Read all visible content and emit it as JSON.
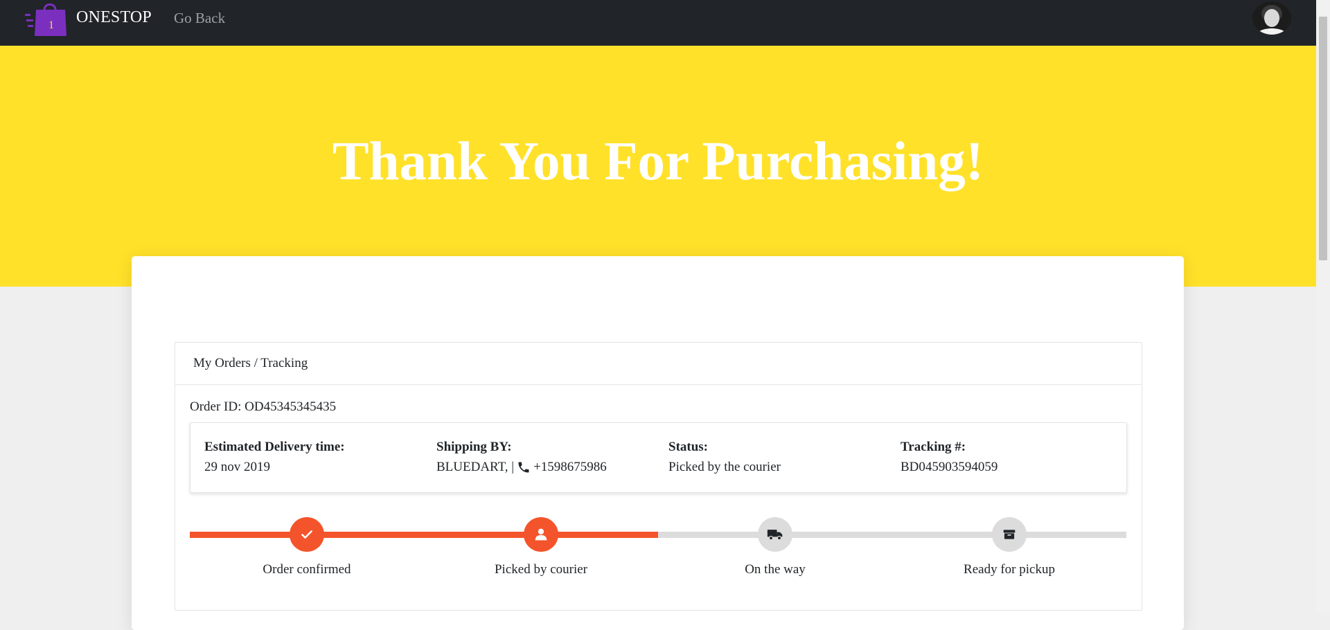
{
  "nav": {
    "logo_badge": "1",
    "brand": "ONESTOP",
    "go_back": "Go Back"
  },
  "hero": {
    "title": "Thank You For Purchasing!"
  },
  "tracking": {
    "breadcrumb": "My Orders / Tracking",
    "order_id": "Order ID: OD45345345435",
    "info": {
      "delivery_label": "Estimated Delivery time:",
      "delivery_value": "29 nov 2019",
      "shipping_label": "Shipping BY:",
      "shipping_value": "BLUEDART, |",
      "shipping_phone": "+1598675986",
      "status_label": "Status:",
      "status_value": "Picked by the courier",
      "tracking_label": "Tracking #:",
      "tracking_value": "BD045903594059"
    },
    "progress_fraction": 0.5,
    "steps": [
      {
        "label": "Order confirmed",
        "icon": "check-icon",
        "active": true
      },
      {
        "label": "Picked by courier",
        "icon": "user-icon",
        "active": true
      },
      {
        "label": "On the way",
        "icon": "truck-icon",
        "active": false
      },
      {
        "label": "Ready for pickup",
        "icon": "box-icon",
        "active": false
      }
    ]
  },
  "colors": {
    "navbar": "#212429",
    "hero": "#ffe12a",
    "accent": "#f4542b",
    "inactive": "#dcdcdc"
  }
}
